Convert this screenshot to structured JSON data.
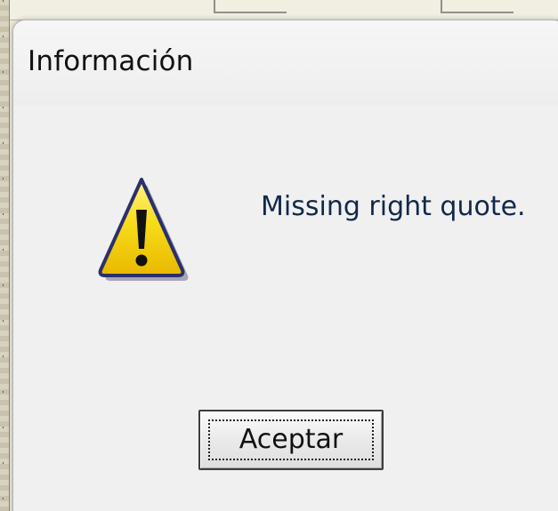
{
  "dialog": {
    "title": "Información",
    "message": "Missing right quote.",
    "icon": "warning-icon",
    "ok_button_label": "Aceptar"
  },
  "colors": {
    "dialog_background": "#f0f0f0",
    "message_text": "#12284a",
    "warning_yellow": "#f5d400",
    "warning_outline": "#2b2f6b"
  }
}
